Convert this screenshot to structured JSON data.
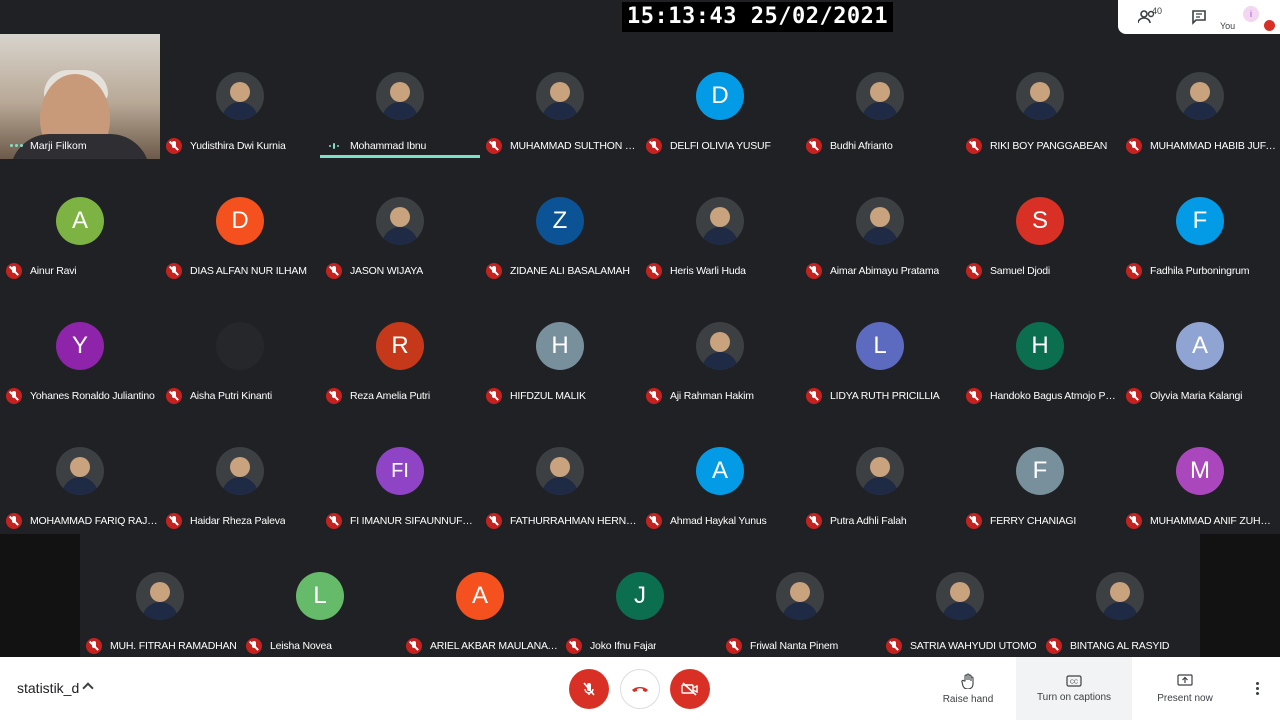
{
  "clock": {
    "time": "15:13:43",
    "date": "25/02/2021"
  },
  "top_panel": {
    "participant_count": "40",
    "you_label": "You"
  },
  "presenter": {
    "name": "Marji Filkom"
  },
  "participants": [
    {
      "name": "Yudisthira Dwi Kurnia",
      "initial": "",
      "color": "#3c4043",
      "photo": true,
      "speaking": false
    },
    {
      "name": "Mohammad Ibnu",
      "initial": "",
      "color": "#3c4043",
      "photo": true,
      "speaking": true
    },
    {
      "name": "MUHAMMAD SULTHON IM...",
      "initial": "",
      "color": "#dadce0",
      "photo": true,
      "speaking": false
    },
    {
      "name": "DELFI OLIVIA YUSUF",
      "initial": "D",
      "color": "#039be5",
      "photo": false,
      "speaking": false
    },
    {
      "name": "Budhi Afrianto",
      "initial": "",
      "color": "#3c4043",
      "photo": true,
      "speaking": false
    },
    {
      "name": "RIKI BOY PANGGABEAN",
      "initial": "",
      "color": "#3c4043",
      "photo": true,
      "speaking": false
    },
    {
      "name": "MUHAMMAD HABIB JUFA...",
      "initial": "",
      "color": "#3c4043",
      "photo": true,
      "speaking": false
    },
    {
      "name": "Ainur Ravi",
      "initial": "A",
      "color": "#7cb342",
      "photo": false,
      "speaking": false
    },
    {
      "name": "DIAS ALFAN NUR ILHAM",
      "initial": "D",
      "color": "#f4511e",
      "photo": false,
      "speaking": false
    },
    {
      "name": "JASON WIJAYA",
      "initial": "",
      "color": "#f9d71c",
      "photo": true,
      "speaking": false
    },
    {
      "name": "ZIDANE ALI BASALAMAH",
      "initial": "Z",
      "color": "#0b5394",
      "photo": false,
      "speaking": false
    },
    {
      "name": "Heris Warli Huda",
      "initial": "",
      "color": "#3c4043",
      "photo": true,
      "speaking": false
    },
    {
      "name": "Aimar Abimayu Pratama",
      "initial": "",
      "color": "#3c4043",
      "photo": true,
      "speaking": false
    },
    {
      "name": "Samuel Djodi",
      "initial": "S",
      "color": "#d93025",
      "photo": false,
      "speaking": false
    },
    {
      "name": "Fadhila Purboningrum",
      "initial": "F",
      "color": "#039be5",
      "photo": false,
      "speaking": false
    },
    {
      "name": "Yohanes Ronaldo Juliantino",
      "initial": "Y",
      "color": "#8e24aa",
      "photo": false,
      "speaking": false
    },
    {
      "name": "Aisha Putri Kinanti",
      "initial": "",
      "color": "#26272b",
      "photo": false,
      "speaking": false
    },
    {
      "name": "Reza Amelia Putri",
      "initial": "R",
      "color": "#c5391a",
      "photo": false,
      "speaking": false
    },
    {
      "name": "HIFDZUL MALIK",
      "initial": "H",
      "color": "#78909c",
      "photo": false,
      "speaking": false
    },
    {
      "name": "Aji Rahman Hakim",
      "initial": "",
      "color": "#3c4043",
      "photo": true,
      "speaking": false
    },
    {
      "name": "LIDYA RUTH PRICILLIA",
      "initial": "L",
      "color": "#5c6bc0",
      "photo": false,
      "speaking": false
    },
    {
      "name": "Handoko Bagus Atmojo Pa...",
      "initial": "H",
      "color": "#0b6e4f",
      "photo": false,
      "speaking": false
    },
    {
      "name": "Olyvia Maria Kalangi",
      "initial": "A",
      "color": "#90a4d4",
      "photo": false,
      "speaking": false
    },
    {
      "name": "MOHAMMAD FARIQ RAJA...",
      "initial": "",
      "color": "#3c4043",
      "photo": true,
      "speaking": false
    },
    {
      "name": "Haidar Rheza Paleva",
      "initial": "",
      "color": "#3c4043",
      "photo": true,
      "speaking": false
    },
    {
      "name": "FI IMANUR SIFAUNNUFUS ...",
      "initial": "FI",
      "color": "#8e44c4",
      "photo": false,
      "speaking": false
    },
    {
      "name": "FATHURRAHMAN HERNA...",
      "initial": "",
      "color": "#1b2a3a",
      "photo": true,
      "speaking": false
    },
    {
      "name": "Ahmad Haykal Yunus",
      "initial": "A",
      "color": "#039be5",
      "photo": false,
      "speaking": false
    },
    {
      "name": "Putra Adhli Falah",
      "initial": "",
      "color": "#3c4043",
      "photo": true,
      "speaking": false
    },
    {
      "name": "FERRY CHANIAGI",
      "initial": "F",
      "color": "#78909c",
      "photo": false,
      "speaking": false
    },
    {
      "name": "MUHAMMAD ANIF ZUHRU...",
      "initial": "M",
      "color": "#ab47bc",
      "photo": false,
      "speaking": false
    },
    {
      "name": "MUH. FITRAH RAMADHAN",
      "initial": "",
      "color": "#3c4043",
      "photo": true,
      "speaking": false
    },
    {
      "name": "Leisha Novea",
      "initial": "L",
      "color": "#66bb6a",
      "photo": false,
      "speaking": false
    },
    {
      "name": "ARIEL AKBAR MAULANA ...",
      "initial": "A",
      "color": "#f4511e",
      "photo": false,
      "speaking": false
    },
    {
      "name": "Joko Ifnu Fajar",
      "initial": "J",
      "color": "#0b6e4f",
      "photo": false,
      "speaking": false
    },
    {
      "name": "Friwal Nanta Pinem",
      "initial": "",
      "color": "#3c4043",
      "photo": true,
      "speaking": false
    },
    {
      "name": "SATRIA WAHYUDI UTOMO",
      "initial": "",
      "color": "#3c4043",
      "photo": true,
      "speaking": false
    },
    {
      "name": "BINTANG AL RASYID",
      "initial": "",
      "color": "#3c4043",
      "photo": true,
      "speaking": false
    }
  ],
  "controls": {
    "meeting_name": "statistik_d",
    "raise_hand": "Raise hand",
    "captions": "Turn on captions",
    "present": "Present now"
  },
  "icons": {
    "people": "people-icon",
    "chat": "chat-icon",
    "mic_off": "mic-off-icon",
    "hang_up": "hang-up-icon",
    "cam_off": "camera-off-icon",
    "hand": "hand-icon",
    "cc": "captions-icon",
    "present": "present-icon",
    "more": "more-vert-icon"
  }
}
